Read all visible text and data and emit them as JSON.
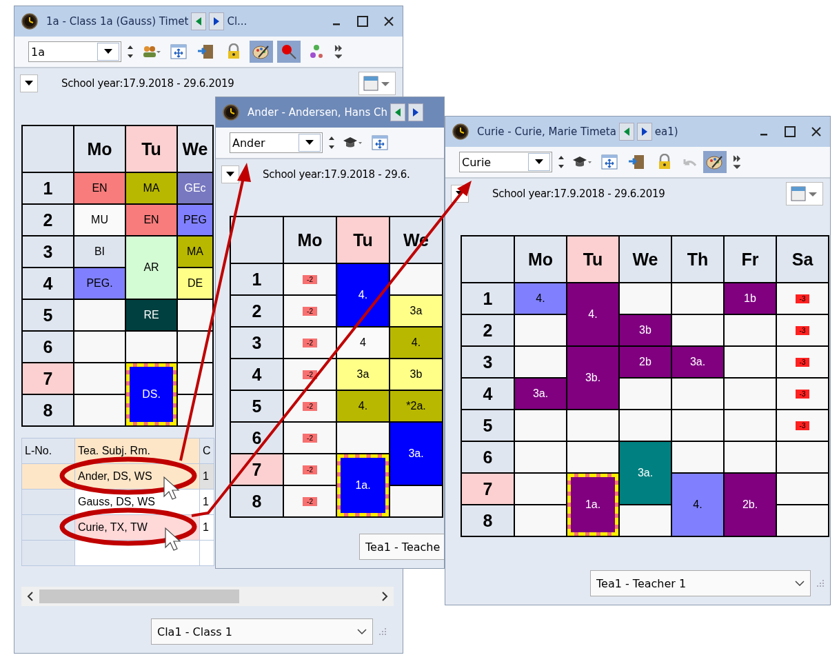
{
  "windows": [
    {
      "title": "1a - Class 1a (Gauss)  Timet",
      "title_tail": "Cl...",
      "active": false,
      "window_controls": true,
      "selector": "1a",
      "toolbar": [
        {
          "kind": "spinner",
          "selected": false,
          "disabled": false
        },
        {
          "kind": "people",
          "selected": false,
          "disabled": false
        },
        {
          "kind": "move",
          "selected": false,
          "disabled": false
        },
        {
          "kind": "door",
          "selected": false,
          "disabled": false
        },
        {
          "kind": "lock",
          "selected": false,
          "disabled": false
        },
        {
          "kind": "palette",
          "selected": true,
          "disabled": false
        },
        {
          "kind": "pin",
          "selected": true,
          "disabled": false
        },
        {
          "kind": "nodes",
          "selected": false,
          "disabled": false
        },
        {
          "kind": "more",
          "selected": false,
          "disabled": false
        }
      ],
      "school_year": "School year:17.9.2018 - 29.6.2019",
      "calendar_button": true,
      "days": [
        {
          "label": "Mo",
          "highlighted": false
        },
        {
          "label": "Tu",
          "highlighted": true
        },
        {
          "label": "We",
          "highlighted": false
        }
      ],
      "periods": [
        {
          "label": "1",
          "highlighted": false,
          "cells": [
            {
              "kind": "lesson",
              "text": "EN",
              "color": "#f87c7c",
              "selected": false
            },
            {
              "kind": "lesson",
              "text": "MA",
              "color": "#b8b800",
              "selected": false
            },
            {
              "kind": "lesson",
              "text": "GEc",
              "color": "#7878c0",
              "selected": false
            }
          ]
        },
        {
          "label": "2",
          "highlighted": false,
          "cells": [
            {
              "kind": "lesson",
              "text": "MU",
              "color": "#fafafa",
              "selected": false
            },
            {
              "kind": "lesson",
              "text": "EN",
              "color": "#f87c7c",
              "selected": false
            },
            {
              "kind": "lesson",
              "text": "PEG",
              "color": "#8080ff",
              "selected": false
            }
          ]
        },
        {
          "label": "3",
          "highlighted": false,
          "cells": [
            {
              "kind": "lesson",
              "text": "BI",
              "color": "#dde4ee",
              "selected": false
            },
            {
              "kind": "lesson_top",
              "text": "AR",
              "color": "#d4fcd4",
              "selected": false
            },
            {
              "kind": "lesson",
              "text": "MA",
              "color": "#b8b800",
              "selected": false
            }
          ]
        },
        {
          "label": "4",
          "highlighted": false,
          "cells": [
            {
              "kind": "lesson",
              "text": "PEG.",
              "color": "#8080ff",
              "selected": false
            },
            {
              "kind": "lesson_under"
            },
            {
              "kind": "lesson",
              "text": "DE",
              "color": "#ffff88",
              "selected": false
            }
          ]
        },
        {
          "label": "5",
          "highlighted": false,
          "cells": [
            {
              "kind": "empty"
            },
            {
              "kind": "lesson",
              "text": "RE",
              "color": "#004040",
              "selected": false
            },
            {
              "kind": "empty"
            }
          ]
        },
        {
          "label": "6",
          "highlighted": false,
          "cells": [
            {
              "kind": "empty"
            },
            {
              "kind": "empty"
            },
            {
              "kind": "empty"
            }
          ]
        },
        {
          "label": "7",
          "highlighted": true,
          "cells": [
            {
              "kind": "empty"
            },
            {
              "kind": "lesson_top",
              "text": "DS.",
              "color": "#0000ff",
              "selected": true
            },
            {
              "kind": "empty"
            }
          ]
        },
        {
          "label": "8",
          "highlighted": false,
          "cells": [
            {
              "kind": "empty"
            },
            {
              "kind": "lesson_under"
            },
            {
              "kind": "empty"
            }
          ]
        }
      ],
      "lesson_table": {
        "columns": [
          "L-No.",
          "Tea. Subj. Rm.",
          "C"
        ],
        "rows": [
          {
            "selected": true,
            "highlighted": false,
            "teacher_subject_room": "Ander, DS, WS",
            "column_3": "1"
          },
          {
            "selected": false,
            "highlighted": false,
            "teacher_subject_room": "Gauss, DS, WS",
            "column_3": "1"
          },
          {
            "selected": false,
            "highlighted": true,
            "teacher_subject_room": "Curie, TX, TW",
            "column_3": "1"
          },
          {
            "selected": false,
            "highlighted": false
          }
        ]
      },
      "footer_combo": "Cla1 - Class 1",
      "footer_arrow": true
    },
    {
      "title": "Ander - Andersen, Hans Ch",
      "active": true,
      "window_controls": false,
      "selector": "Ander",
      "toolbar": [
        {
          "kind": "spinner",
          "selected": false,
          "disabled": false
        },
        {
          "kind": "mortarboard",
          "selected": false,
          "disabled": false
        },
        {
          "kind": "move",
          "selected": false,
          "disabled": false
        }
      ],
      "school_year": "School year:17.9.2018 - 29.6.",
      "calendar_button": false,
      "days": [
        {
          "label": "Mo",
          "highlighted": false
        },
        {
          "label": "Tu",
          "highlighted": true
        },
        {
          "label": "We",
          "highlighted": false
        }
      ],
      "periods": [
        {
          "label": "1",
          "highlighted": false,
          "cells": [
            {
              "kind": "blocked",
              "text": "-2",
              "color": "#f87070"
            },
            {
              "kind": "lesson_top",
              "text": "4.",
              "color": "#0000ff",
              "selected": false
            },
            {
              "kind": "empty"
            }
          ]
        },
        {
          "label": "2",
          "highlighted": false,
          "cells": [
            {
              "kind": "blocked",
              "text": "-2",
              "color": "#f87070"
            },
            {
              "kind": "lesson_under"
            },
            {
              "kind": "lesson",
              "text": "3a",
              "color": "#ffff88",
              "selected": false
            }
          ]
        },
        {
          "label": "3",
          "highlighted": false,
          "cells": [
            {
              "kind": "blocked",
              "text": "-2",
              "color": "#f87070"
            },
            {
              "kind": "lesson",
              "text": "4",
              "color": "#fafafa",
              "selected": false
            },
            {
              "kind": "lesson",
              "text": "4.",
              "color": "#b8b800",
              "selected": false
            }
          ]
        },
        {
          "label": "4",
          "highlighted": false,
          "cells": [
            {
              "kind": "blocked",
              "text": "-2",
              "color": "#f87070"
            },
            {
              "kind": "lesson",
              "text": "3a",
              "color": "#ffff88",
              "selected": false
            },
            {
              "kind": "lesson",
              "text": "3b",
              "color": "#ffff88",
              "selected": false
            }
          ]
        },
        {
          "label": "5",
          "highlighted": false,
          "cells": [
            {
              "kind": "blocked",
              "text": "-2",
              "color": "#f87070"
            },
            {
              "kind": "lesson",
              "text": "4.",
              "color": "#b8b800",
              "selected": false
            },
            {
              "kind": "lesson",
              "text": "*2a.",
              "color": "#b8b800",
              "selected": false
            }
          ]
        },
        {
          "label": "6",
          "highlighted": false,
          "cells": [
            {
              "kind": "blocked",
              "text": "-2",
              "color": "#f87070"
            },
            {
              "kind": "empty"
            },
            {
              "kind": "lesson_top",
              "text": "3a.",
              "color": "#0000ff",
              "selected": false
            }
          ]
        },
        {
          "label": "7",
          "highlighted": true,
          "cells": [
            {
              "kind": "blocked",
              "text": "-2",
              "color": "#f87070"
            },
            {
              "kind": "lesson_top",
              "text": "1a.",
              "color": "#0000ff",
              "selected": true
            },
            {
              "kind": "lesson_under"
            }
          ]
        },
        {
          "label": "8",
          "highlighted": false,
          "cells": [
            {
              "kind": "blocked",
              "text": "-2",
              "color": "#f87070"
            },
            {
              "kind": "lesson_under"
            },
            {
              "kind": "empty"
            }
          ]
        }
      ],
      "footer_combo": "Tea1 - Teache",
      "footer_arrow": false
    },
    {
      "title": "Curie - Curie, Marie  Timeta",
      "title_tail": "ea1)",
      "active": false,
      "window_controls": true,
      "selector": "Curie",
      "toolbar": [
        {
          "kind": "spinner",
          "selected": false,
          "disabled": false
        },
        {
          "kind": "mortarboard",
          "selected": false,
          "disabled": false
        },
        {
          "kind": "move",
          "selected": false,
          "disabled": false
        },
        {
          "kind": "door",
          "selected": false,
          "disabled": false
        },
        {
          "kind": "lock",
          "selected": false,
          "disabled": false
        },
        {
          "kind": "undo",
          "selected": false,
          "disabled": true
        },
        {
          "kind": "palette",
          "selected": true,
          "disabled": false
        },
        {
          "kind": "more",
          "selected": false,
          "disabled": false
        }
      ],
      "school_year": "School year:17.9.2018 - 29.6.2019",
      "calendar_button": true,
      "days": [
        {
          "label": "Mo",
          "highlighted": false
        },
        {
          "label": "Tu",
          "highlighted": true
        },
        {
          "label": "We",
          "highlighted": false
        },
        {
          "label": "Th",
          "highlighted": false
        },
        {
          "label": "Fr",
          "highlighted": false
        },
        {
          "label": "Sa",
          "highlighted": false
        }
      ],
      "periods": [
        {
          "label": "1",
          "highlighted": false,
          "cells": [
            {
              "kind": "lesson",
              "text": "4.",
              "color": "#8080ff",
              "selected": false
            },
            {
              "kind": "lesson_top",
              "text": "4.",
              "color": "#800080",
              "selected": false
            },
            {
              "kind": "empty"
            },
            {
              "kind": "empty"
            },
            {
              "kind": "lesson",
              "text": "1b",
              "color": "#800080",
              "selected": false
            },
            {
              "kind": "blocked",
              "text": "-3",
              "color": "#ff2020"
            }
          ]
        },
        {
          "label": "2",
          "highlighted": false,
          "cells": [
            {
              "kind": "empty"
            },
            {
              "kind": "lesson_under"
            },
            {
              "kind": "lesson",
              "text": "3b",
              "color": "#800080",
              "selected": false
            },
            {
              "kind": "empty"
            },
            {
              "kind": "empty"
            },
            {
              "kind": "blocked",
              "text": "-3",
              "color": "#ff2020"
            }
          ]
        },
        {
          "label": "3",
          "highlighted": false,
          "cells": [
            {
              "kind": "empty"
            },
            {
              "kind": "lesson_top",
              "text": "3b.",
              "color": "#800080",
              "selected": false
            },
            {
              "kind": "lesson",
              "text": "2b",
              "color": "#800080",
              "selected": false
            },
            {
              "kind": "lesson",
              "text": "3a.",
              "color": "#800080",
              "selected": false
            },
            {
              "kind": "empty"
            },
            {
              "kind": "blocked",
              "text": "-3",
              "color": "#ff2020"
            }
          ]
        },
        {
          "label": "4",
          "highlighted": false,
          "cells": [
            {
              "kind": "lesson",
              "text": "3a.",
              "color": "#800080",
              "selected": false
            },
            {
              "kind": "lesson_under"
            },
            {
              "kind": "empty"
            },
            {
              "kind": "empty"
            },
            {
              "kind": "empty"
            },
            {
              "kind": "blocked",
              "text": "-3",
              "color": "#ff2020"
            }
          ]
        },
        {
          "label": "5",
          "highlighted": false,
          "cells": [
            {
              "kind": "empty"
            },
            {
              "kind": "empty"
            },
            {
              "kind": "empty"
            },
            {
              "kind": "empty"
            },
            {
              "kind": "empty"
            },
            {
              "kind": "blocked",
              "text": "-3",
              "color": "#ff2020"
            }
          ]
        },
        {
          "label": "6",
          "highlighted": false,
          "cells": [
            {
              "kind": "empty"
            },
            {
              "kind": "empty"
            },
            {
              "kind": "lesson_top",
              "text": "3a.",
              "color": "#008080",
              "selected": false
            },
            {
              "kind": "empty"
            },
            {
              "kind": "empty"
            },
            {
              "kind": "empty"
            }
          ]
        },
        {
          "label": "7",
          "highlighted": true,
          "cells": [
            {
              "kind": "empty"
            },
            {
              "kind": "lesson_top",
              "text": "1a.",
              "color": "#800080",
              "selected": true
            },
            {
              "kind": "lesson_under"
            },
            {
              "kind": "lesson_top",
              "text": "4.",
              "color": "#8080ff",
              "selected": false
            },
            {
              "kind": "lesson_top",
              "text": "2b.",
              "color": "#800080",
              "selected": false
            },
            {
              "kind": "empty"
            }
          ]
        },
        {
          "label": "8",
          "highlighted": false,
          "cells": [
            {
              "kind": "empty"
            },
            {
              "kind": "lesson_under"
            },
            {
              "kind": "empty"
            },
            {
              "kind": "lesson_under"
            },
            {
              "kind": "lesson_under"
            },
            {
              "kind": "empty"
            }
          ]
        }
      ],
      "footer_combo": "Tea1 - Teacher 1",
      "footer_arrow": true
    }
  ]
}
